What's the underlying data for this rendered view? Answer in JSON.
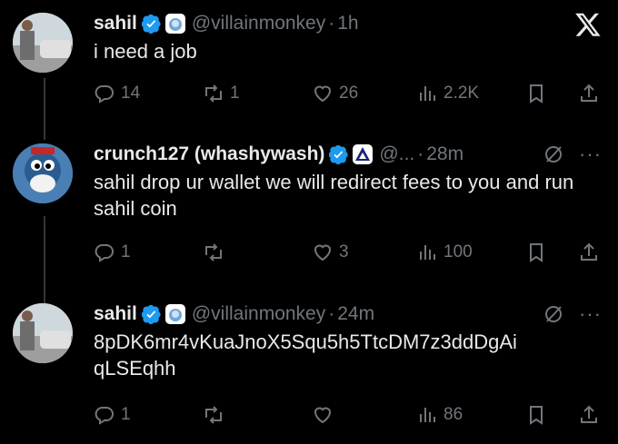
{
  "tweets": [
    {
      "name": "sahil",
      "handle": "@villainmonkey",
      "time": "1h",
      "text": "i need a job",
      "replies": "14",
      "reposts": "1",
      "likes": "26",
      "views": "2.2K"
    },
    {
      "name": "crunch127 (whashywash)",
      "handle": "@...",
      "time": "28m",
      "text": "sahil drop ur wallet we will redirect fees to you and run sahil coin",
      "replies": "1",
      "reposts": "",
      "likes": "3",
      "views": "100"
    },
    {
      "name": "sahil",
      "handle": "@villainmonkey",
      "time": "24m",
      "text": "8pDK6mr4vKuaJnoX5Squ5h5TtcDM7z3ddDgAi qLSEqhh",
      "replies": "1",
      "reposts": "",
      "likes": "",
      "views": "86"
    }
  ],
  "separator": "·",
  "colors": {
    "background": "#000000",
    "text": "#e7e9ea",
    "muted": "#71767b",
    "verified": "#1d9bf0"
  },
  "icons": [
    "x-logo-icon",
    "verified-icon",
    "reply-icon",
    "repost-icon",
    "like-icon",
    "views-icon",
    "bookmark-icon",
    "share-icon",
    "grok-icon",
    "more-icon"
  ]
}
